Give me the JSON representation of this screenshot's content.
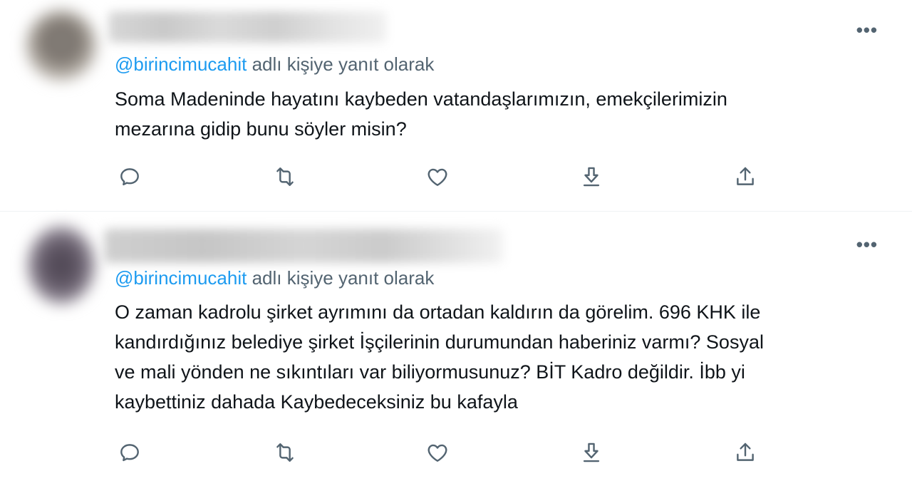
{
  "tweets": [
    {
      "reply_handle": "@birincimucahit",
      "reply_suffix": " adlı kişiye yanıt olarak",
      "more_label": "•••",
      "text_lines": [
        "Soma Madeninde hayatını kaybeden vatandaşlarımızın, emekçilerimizin",
        "mezarına gidip bunu söyler misin?"
      ]
    },
    {
      "reply_handle": "@birincimucahit",
      "reply_suffix": " adlı kişiye yanıt olarak",
      "more_label": "•••",
      "text_lines": [
        "O zaman kadrolu şirket ayrımını da ortadan kaldırın da görelim. 696 KHK ile",
        "kandırdığınız belediye şirket İşçilerinin durumundan haberiniz varmı? Sosyal",
        "ve mali yönden ne sıkıntıları var biliyormusunuz? BİT Kadro değildir. İbb yi",
        "kaybettiniz dahada Kaybedeceksiniz bu kafayla"
      ]
    }
  ],
  "icons": {
    "reply": "reply-icon",
    "retweet": "retweet-icon",
    "like": "like-icon",
    "download": "download-icon",
    "share": "share-icon"
  },
  "colors": {
    "accent": "#1d9bf0",
    "muted": "#536471",
    "text": "#0f1419",
    "divider": "#eff3f4"
  }
}
